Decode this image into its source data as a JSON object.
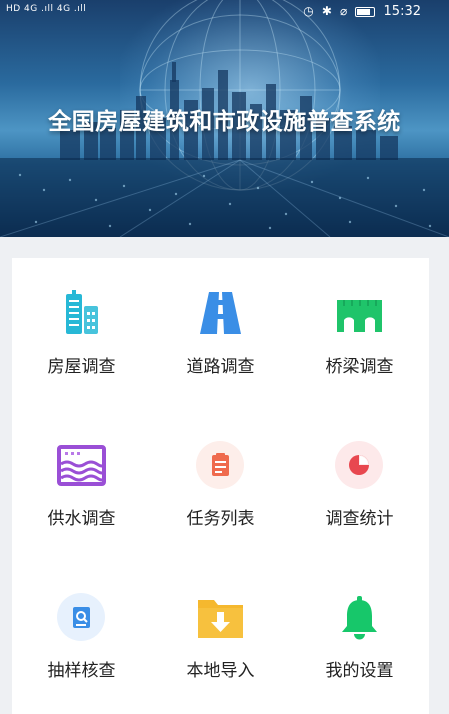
{
  "status_bar": {
    "left_text": "HD 4G .ıll 4G .ıll",
    "time": "15:32"
  },
  "banner": {
    "title": "全国房屋建筑和市政设施普查系统"
  },
  "menu": {
    "items": [
      {
        "label": "房屋调查",
        "icon": "building-icon",
        "color": "#27b8d6"
      },
      {
        "label": "道路调查",
        "icon": "road-icon",
        "color": "#3a8ee6"
      },
      {
        "label": "桥梁调查",
        "icon": "bridge-icon",
        "color": "#1fc46a"
      },
      {
        "label": "供水调查",
        "icon": "water-supply-icon",
        "color": "#9a4fd6"
      },
      {
        "label": "任务列表",
        "icon": "task-list-icon",
        "color": "#ef6a4d"
      },
      {
        "label": "调查统计",
        "icon": "statistics-pie-icon",
        "color": "#e8474f"
      },
      {
        "label": "抽样核查",
        "icon": "sample-check-icon",
        "color": "#3a8ee6"
      },
      {
        "label": "本地导入",
        "icon": "local-import-folder-icon",
        "color": "#f5b82e"
      },
      {
        "label": "我的设置",
        "icon": "bell-settings-icon",
        "color": "#17c76a"
      }
    ]
  }
}
